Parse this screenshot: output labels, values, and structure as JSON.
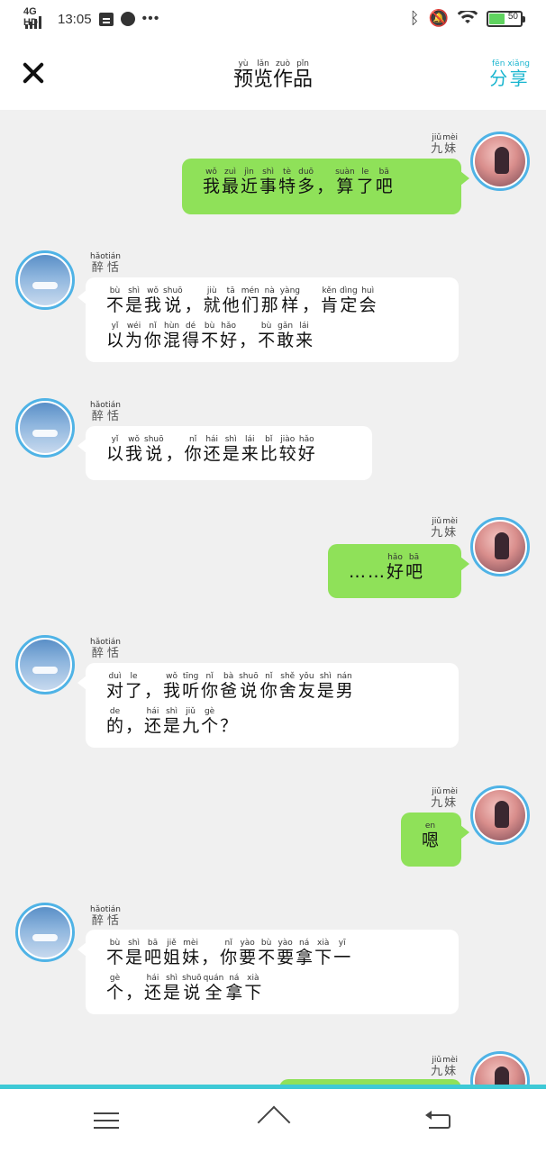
{
  "status_bar": {
    "network": "4G HD",
    "time": "13:05",
    "more": "•••",
    "battery_level": "50",
    "battery_fraction": 0.5,
    "icons": [
      "signal-icon",
      "calendar-icon",
      "moon-icon",
      "bluetooth-icon",
      "mute-icon",
      "wifi-icon",
      "battery-icon"
    ]
  },
  "header": {
    "close_icon": "close-icon",
    "title": [
      [
        "预",
        "yù"
      ],
      [
        "览",
        "lǎn"
      ],
      [
        "作",
        "zuò"
      ],
      [
        "品",
        "pǐn"
      ]
    ],
    "share": [
      [
        "分",
        "fēn"
      ],
      [
        "享",
        "xiǎng"
      ]
    ]
  },
  "colors": {
    "sent_bubble": "#8fe159",
    "received_bubble": "#ffffff",
    "background": "#f0f0f0",
    "accent": "#3ec9d6",
    "avatar_ring": "#4fb3e6",
    "share": "#19b5cf"
  },
  "messages": [
    {
      "side": "right",
      "name": [
        [
          "九",
          "jiǔ"
        ],
        [
          "妹",
          "mèi"
        ]
      ],
      "lines": [
        [
          [
            "我",
            "wǒ"
          ],
          [
            "最",
            "zuì"
          ],
          [
            "近",
            "jìn"
          ],
          [
            "事",
            "shì"
          ],
          [
            "特",
            "tè"
          ],
          [
            "多",
            "duō"
          ],
          [
            "，",
            ""
          ],
          [
            "算",
            "suàn"
          ],
          [
            "了",
            "le"
          ],
          [
            "吧",
            "bā"
          ]
        ]
      ]
    },
    {
      "side": "left",
      "name": [
        [
          "醉",
          "hǎo"
        ],
        [
          "恬",
          "tián"
        ]
      ],
      "lines": [
        [
          [
            "不",
            "bù"
          ],
          [
            "是",
            "shì"
          ],
          [
            "我",
            "wǒ"
          ],
          [
            "说",
            "shuō"
          ],
          [
            "，",
            ""
          ],
          [
            "就",
            "jiù"
          ],
          [
            "他",
            "tā"
          ],
          [
            "们",
            "mén"
          ],
          [
            "那",
            "nà"
          ],
          [
            "样",
            "yàng"
          ],
          [
            "，",
            ""
          ],
          [
            "肯",
            "kěn"
          ],
          [
            "定",
            "dìng"
          ],
          [
            "会",
            "huì"
          ]
        ],
        [
          [
            "以",
            "yǐ"
          ],
          [
            "为",
            "wéi"
          ],
          [
            "你",
            "nǐ"
          ],
          [
            "混",
            "hùn"
          ],
          [
            "得",
            "dé"
          ],
          [
            "不",
            "bù"
          ],
          [
            "好",
            "hǎo"
          ],
          [
            "，",
            ""
          ],
          [
            "不",
            "bù"
          ],
          [
            "敢",
            "gǎn"
          ],
          [
            "来",
            "lái"
          ]
        ]
      ]
    },
    {
      "side": "left",
      "name": [
        [
          "醉",
          "hǎo"
        ],
        [
          "恬",
          "tián"
        ]
      ],
      "lines": [
        [
          [
            "以",
            "yǐ"
          ],
          [
            "我",
            "wǒ"
          ],
          [
            "说",
            "shuō"
          ],
          [
            "，",
            ""
          ],
          [
            "你",
            "nǐ"
          ],
          [
            "还",
            "hái"
          ],
          [
            "是",
            "shì"
          ],
          [
            "来",
            "lái"
          ],
          [
            "比",
            "bǐ"
          ],
          [
            "较",
            "jiào"
          ],
          [
            "好",
            "hǎo"
          ]
        ]
      ]
    },
    {
      "side": "right",
      "name": [
        [
          "九",
          "jiǔ"
        ],
        [
          "妹",
          "mèi"
        ]
      ],
      "lines": [
        [
          [
            "…",
            ""
          ],
          [
            "…",
            ""
          ],
          [
            "好",
            "hǎo"
          ],
          [
            "吧",
            "bā"
          ]
        ]
      ]
    },
    {
      "side": "left",
      "name": [
        [
          "醉",
          "hǎo"
        ],
        [
          "恬",
          "tián"
        ]
      ],
      "lines": [
        [
          [
            "对",
            "duì"
          ],
          [
            "了",
            "le"
          ],
          [
            "，",
            ""
          ],
          [
            "我",
            "wǒ"
          ],
          [
            "听",
            "tīng"
          ],
          [
            "你",
            "nǐ"
          ],
          [
            "爸",
            "bà"
          ],
          [
            "说",
            "shuō"
          ],
          [
            "你",
            "nǐ"
          ],
          [
            "舍",
            "shě"
          ],
          [
            "友",
            "yǒu"
          ],
          [
            "是",
            "shì"
          ],
          [
            "男",
            "nán"
          ]
        ],
        [
          [
            "的",
            "de"
          ],
          [
            "，",
            ""
          ],
          [
            "还",
            "hái"
          ],
          [
            "是",
            "shì"
          ],
          [
            "九",
            "jiǔ"
          ],
          [
            "个",
            "gè"
          ],
          [
            "？",
            ""
          ]
        ]
      ]
    },
    {
      "side": "right",
      "name": [
        [
          "九",
          "jiǔ"
        ],
        [
          "妹",
          "mèi"
        ]
      ],
      "lines": [
        [
          [
            "嗯",
            "en"
          ]
        ]
      ]
    },
    {
      "side": "left",
      "name": [
        [
          "醉",
          "hǎo"
        ],
        [
          "恬",
          "tián"
        ]
      ],
      "lines": [
        [
          [
            "不",
            "bù"
          ],
          [
            "是",
            "shì"
          ],
          [
            "吧",
            "bā"
          ],
          [
            "姐",
            "jiě"
          ],
          [
            "妹",
            "mèi"
          ],
          [
            "，",
            ""
          ],
          [
            "你",
            "nǐ"
          ],
          [
            "要",
            "yào"
          ],
          [
            "不",
            "bù"
          ],
          [
            "要",
            "yào"
          ],
          [
            "拿",
            "ná"
          ],
          [
            "下",
            "xià"
          ],
          [
            "一",
            "yī"
          ]
        ],
        [
          [
            "个",
            "gè"
          ],
          [
            "，",
            ""
          ],
          [
            "还",
            "hái"
          ],
          [
            "是",
            "shì"
          ],
          [
            "说",
            "shuō"
          ],
          [
            "全",
            "quán"
          ],
          [
            "拿",
            "ná"
          ],
          [
            "下",
            "xià"
          ]
        ]
      ]
    },
    {
      "side": "right",
      "name": [
        [
          "九",
          "jiǔ"
        ],
        [
          "妹",
          "mèi"
        ]
      ],
      "lines": []
    }
  ],
  "navbar": {
    "menu_icon": "menu-icon",
    "home_icon": "home-icon",
    "back_icon": "back-icon"
  }
}
